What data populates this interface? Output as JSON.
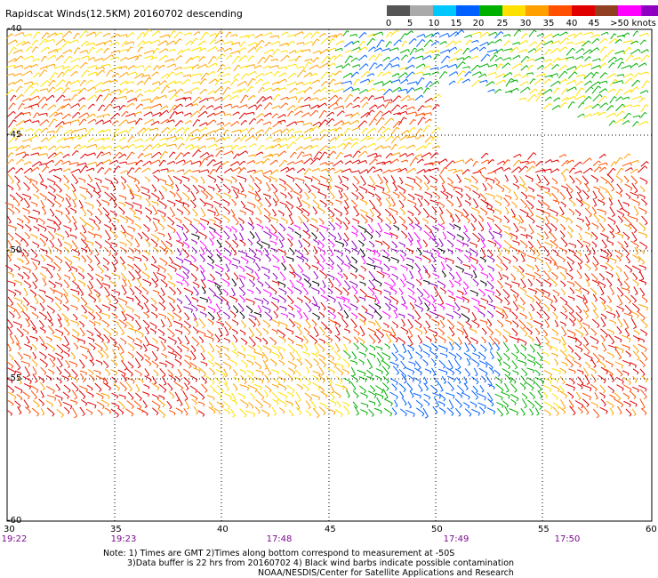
{
  "title": "Rapidscat Winds(12.5KM) 20160702 descending",
  "legend": {
    "labels": [
      "0",
      "5",
      "10",
      "15",
      "20",
      "25",
      "30",
      "35",
      "40",
      "45",
      ">50 knots"
    ],
    "colors": [
      "#555555",
      "#aaaaaa",
      "#00c8ff",
      "#0060ff",
      "#00b000",
      "#ffe000",
      "#ffa000",
      "#ff5000",
      "#e00000",
      "#904020",
      "#ff00ff",
      "#9000c0",
      "#400080"
    ]
  },
  "axes": {
    "lon_ticks": [
      "30",
      "35",
      "40",
      "45",
      "50",
      "55",
      "60"
    ],
    "lat_ticks": [
      "-40",
      "-45",
      "-50",
      "-55",
      "-60"
    ]
  },
  "times": [
    "19:22",
    "19:23",
    "17:48",
    "17:49",
    "17:50"
  ],
  "notes": [
    "Note: 1) Times are GMT 2)Times along bottom correspond to measurement at -50S",
    "3)Data buffer is 22 hrs from 20160702 4) Black wind barbs indicate possible contamination",
    "NOAA/NESDIS/Center for Satellite Applications and Research"
  ]
}
